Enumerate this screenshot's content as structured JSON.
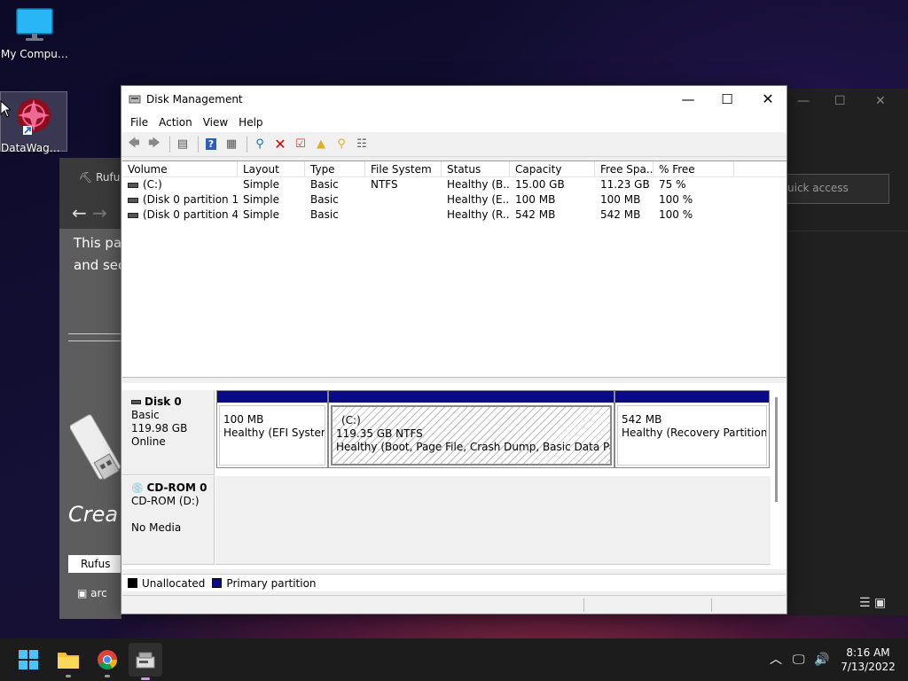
{
  "desktop": {
    "icons": [
      {
        "label": "My Computer"
      },
      {
        "label": "DataWagon..."
      }
    ]
  },
  "background_windows": {
    "rufus": {
      "title": "Rufu",
      "text_line1": "This pa",
      "text_line2": "and sec",
      "heading": "Crea",
      "tab": "Rufus",
      "row": "arc"
    },
    "explorer": {
      "search_placeholder": "uick access"
    }
  },
  "window": {
    "title": "Disk Management",
    "menu": [
      "File",
      "Action",
      "View",
      "Help"
    ]
  },
  "volume_list": {
    "columns": [
      "Volume",
      "Layout",
      "Type",
      "File System",
      "Status",
      "Capacity",
      "Free Spa...",
      "% Free"
    ],
    "rows": [
      [
        "(C:)",
        "Simple",
        "Basic",
        "NTFS",
        "Healthy (B...",
        "15.00 GB",
        "11.23 GB",
        "75 %"
      ],
      [
        "(Disk 0 partition 1)",
        "Simple",
        "Basic",
        "",
        "Healthy (E...",
        "100 MB",
        "100 MB",
        "100 %"
      ],
      [
        "(Disk 0 partition 4)",
        "Simple",
        "Basic",
        "",
        "Healthy (R...",
        "542 MB",
        "542 MB",
        "100 %"
      ]
    ]
  },
  "disks": {
    "disk0": {
      "name": "Disk 0",
      "type": "Basic",
      "size": "119.98 GB",
      "state": "Online",
      "partitions": [
        {
          "letter": "",
          "size": "100 MB",
          "status": "Healthy (EFI System Partition)"
        },
        {
          "letter": "(C:)",
          "size": "119.35 GB NTFS",
          "status": "Healthy (Boot, Page File, Crash Dump, Basic Data Partition)"
        },
        {
          "letter": "",
          "size": "542 MB",
          "status": "Healthy (Recovery Partition)"
        }
      ]
    },
    "cdrom0": {
      "name": "CD-ROM 0",
      "type": "CD-ROM (D:)",
      "state": "No Media"
    }
  },
  "legend": {
    "unallocated": "Unallocated",
    "primary": "Primary partition",
    "unallocated_color": "#000000",
    "primary_color": "#0a0a86"
  },
  "taskbar": {
    "time": "8:16 AM",
    "date": "7/13/2022"
  }
}
